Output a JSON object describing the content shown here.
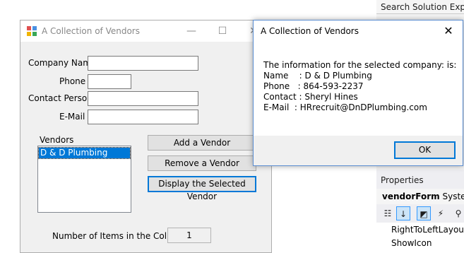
{
  "ide": {
    "search_label": "Search Solution Explor",
    "properties_header": "Properties",
    "object_name": "vendorForm",
    "object_type": "System.",
    "toolbar_icons": [
      "categorized-icon",
      "alphabetical-icon",
      "properties-icon",
      "events-icon",
      "search-icon"
    ],
    "property_rows": [
      "RightToLeftLayout",
      "ShowIcon"
    ]
  },
  "form": {
    "title": "A Collection of Vendors",
    "minimize": "—",
    "maximize": "☐",
    "close": "✕",
    "labels": {
      "company_name": "Company Name",
      "phone": "Phone",
      "contact_person": "Contact Person",
      "email": "E-Mail"
    },
    "fields": {
      "company_name": "",
      "phone": "",
      "contact_person": "",
      "email": ""
    },
    "vendors_label": "Vendors",
    "vendors": [
      "D & D Plumbing"
    ],
    "buttons": {
      "add": "Add a Vendor",
      "remove": "Remove a Vendor",
      "display": "Display the Selected Vendor"
    },
    "count_label": "Number of Items in the Collection:",
    "count_value": "1"
  },
  "message_box": {
    "title": "A Collection of Vendors",
    "close": "✕",
    "lines": [
      "The information for the selected company: is:",
      "Name    : D & D Plumbing",
      "Phone   : 864-593-2237",
      "Contact : Sheryl Hines",
      "E-Mail  : HRrecruit@DnDPlumbing.com"
    ],
    "ok_label": "OK"
  },
  "colors": {
    "accent": "#0078d7",
    "form_bg": "#f0f0f0"
  }
}
